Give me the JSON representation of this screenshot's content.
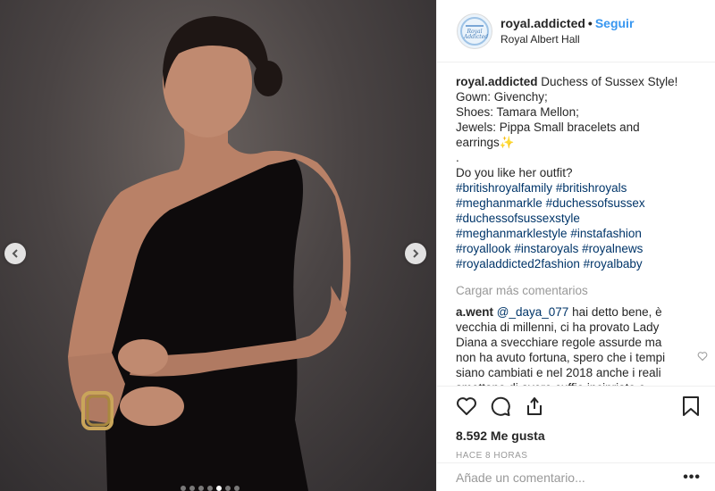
{
  "header": {
    "username": "royal.addicted",
    "separator": "•",
    "follow_label": "Seguir",
    "location": "Royal Albert Hall",
    "avatar_text": "Royal Addicted"
  },
  "caption": {
    "username": "royal.addicted",
    "lines": [
      "Duchess of Sussex Style!",
      "Gown: Givenchy;",
      "Shoes: Tamara Mellon;",
      "Jewels: Pippa Small bracelets and",
      "earrings",
      ".",
      "Do you like her outfit?"
    ],
    "sparkle": "✨",
    "hashtags": [
      "#britishroyalfamily",
      "#britishroyals",
      "#meghanmarkle",
      "#duchessofsussex",
      "#duchessofsussexstyle",
      "#meghanmarklestyle",
      "#instafashion",
      "#royallook",
      "#instaroyals",
      "#royalnews",
      "#royaladdicted2fashion",
      "#royalbaby"
    ]
  },
  "load_more_label": "Cargar más comentarios",
  "comment": {
    "username": "a.went",
    "mention": "@_daya_077",
    "text": " hai detto bene, è vecchia di millenni, ci ha provato Lady Diana a svecchiare regole assurde ma non ha avuto fortuna, spero che i tempi siano cambiati e nel 2018 anche i reali smettano di avere cuffie incipriate e"
  },
  "likes": "8.592 Me gusta",
  "timestamp": "HACE 8 HORAS",
  "add_comment_placeholder": "Añade un comentario...",
  "options_label": "•••",
  "carousel": {
    "slides": 7,
    "active_index": 4
  },
  "icons": {
    "prev": "chevron-left-icon",
    "next": "chevron-right-icon",
    "like": "heart-icon",
    "comment": "comment-bubble-icon",
    "share": "share-icon",
    "save": "bookmark-icon",
    "comment_like": "small-heart-icon"
  },
  "colors": {
    "link": "#3897f0",
    "hashtag": "#003569",
    "muted": "#999999"
  }
}
